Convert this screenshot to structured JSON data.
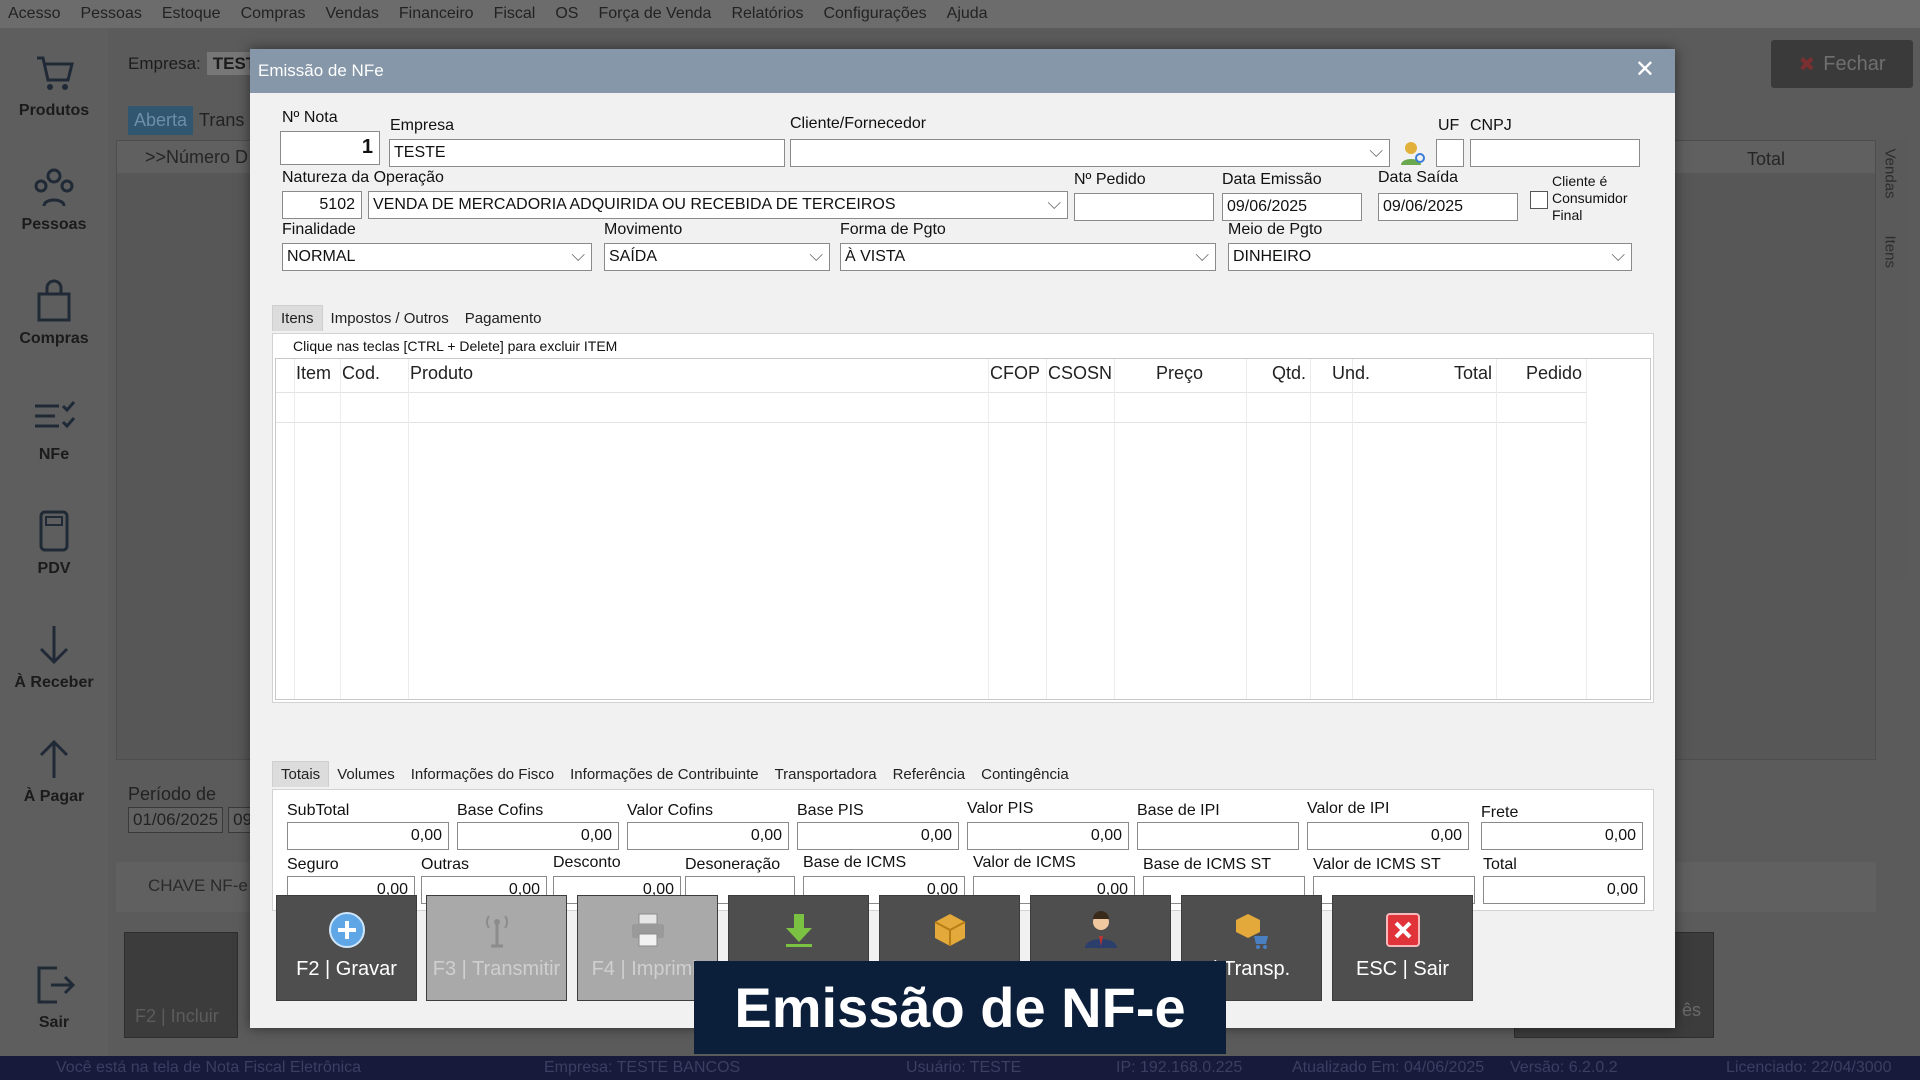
{
  "menubar": [
    "Acesso",
    "Pessoas",
    "Estoque",
    "Compras",
    "Vendas",
    "Financeiro",
    "Fiscal",
    "OS",
    "Força de Venda",
    "Relatórios",
    "Configurações",
    "Ajuda"
  ],
  "sidebar": {
    "items": [
      {
        "label": "Produtos",
        "icon": "cart-icon"
      },
      {
        "label": "Pessoas",
        "icon": "people-icon"
      },
      {
        "label": "Compras",
        "icon": "shopping-bag-icon"
      },
      {
        "label": "NFe",
        "icon": "checklist-icon"
      },
      {
        "label": "PDV",
        "icon": "pos-terminal-icon"
      },
      {
        "label": "À Receber",
        "icon": "arrow-down-icon"
      },
      {
        "label": "À Pagar",
        "icon": "arrow-up-icon"
      },
      {
        "label": "Sair",
        "icon": "exit-icon"
      }
    ]
  },
  "background": {
    "empresa_label": "Empresa:",
    "empresa_value": "TEST",
    "fechar": "Fechar",
    "tab_aberta": "Aberta",
    "tab_trans": "Trans",
    "grid_header_numero": ">>Número D",
    "grid_header_total": "Total",
    "side_vendas": "Vendas",
    "side_itens": "Itens",
    "periodo_label": "Período de",
    "periodo_date": "01/06/2025",
    "periodo_date2": "09",
    "chave": "CHAVE NF-e",
    "bg_btn_1": "F2 | Incluir",
    "bg_btn_last": "ês"
  },
  "statusbar": {
    "msg": "Você está na tela de Nota Fiscal Eletrônica",
    "empresa": "Empresa: TESTE BANCOS",
    "usuario": "Usuário: TESTE",
    "ip": "IP: 192.168.0.225",
    "atualizado": "Atualizado Em: 04/06/2025",
    "versao": "Versão: 6.2.0.2",
    "licenciado": "Licenciado: 22/04/3000"
  },
  "dialog": {
    "title": "Emissão de NFe",
    "close": "✕",
    "header": {
      "nota_label": "Nº Nota",
      "nota_value": "1",
      "empresa_label": "Empresa",
      "empresa_value": "TESTE",
      "cliente_label": "Cliente/Fornecedor",
      "cliente_value": "",
      "uf_label": "UF",
      "uf_value": "",
      "cnpj_label": "CNPJ",
      "cnpj_value": "",
      "natureza_label": "Natureza da Operação",
      "natureza_code": "5102",
      "natureza_value": "VENDA DE MERCADORIA ADQUIRIDA OU RECEBIDA DE TERCEIROS",
      "pedido_label": "Nº Pedido",
      "pedido_value": "",
      "emissao_label": "Data Emissão",
      "emissao_value": "09/06/2025",
      "saida_label": "Data Saída",
      "saida_value": "09/06/2025",
      "consumidor_label_1": "Cliente é",
      "consumidor_label_2": "Consumidor",
      "consumidor_label_3": "Final",
      "finalidade_label": "Finalidade",
      "finalidade_value": "NORMAL",
      "movimento_label": "Movimento",
      "movimento_value": "SAÍDA",
      "forma_label": "Forma de Pgto",
      "forma_value": "À VISTA",
      "meio_label": "Meio de Pgto",
      "meio_value": "DINHEIRO"
    },
    "item_tabs": [
      "Itens",
      "Impostos",
      "/ Outros",
      "Pagamento"
    ],
    "items_hint": "Clique nas teclas [CTRL + Delete] para excluir ITEM",
    "columns": [
      "Item",
      "Cod.",
      "Produto",
      "CFOP",
      "CSOSN",
      "Preço",
      "Qtd.",
      "Und.",
      "Total",
      "Pedido"
    ],
    "bottom_tabs": [
      "Totais",
      "Volumes",
      "Informações do Fisco",
      "Informações de Contribuinte",
      "Transportadora",
      "Referência",
      "Contingência"
    ],
    "totals_row1": [
      {
        "label": "SubTotal",
        "value": "0,00"
      },
      {
        "label": "Base Cofins",
        "value": "0,00"
      },
      {
        "label": "Valor Cofins",
        "value": "0,00"
      },
      {
        "label": "Base PIS",
        "value": "0,00"
      },
      {
        "label": "Valor PIS",
        "value": "0,00"
      },
      {
        "label": "Base de IPI",
        "value": ""
      },
      {
        "label": "Valor de IPI",
        "value": "0,00"
      },
      {
        "label": "Frete",
        "value": "0,00"
      }
    ],
    "totals_row2": [
      {
        "label": "Seguro",
        "value": "0,00"
      },
      {
        "label": "Outras",
        "value": "0,00"
      },
      {
        "label": "Desconto",
        "value": "0,00"
      },
      {
        "label": "Desoneração",
        "value": ""
      },
      {
        "label": "Base de ICMS",
        "value": "0,00"
      },
      {
        "label": "Valor de ICMS",
        "value": "0,00"
      },
      {
        "label": "Base de ICMS ST",
        "value": ""
      },
      {
        "label": "Valor de ICMS ST",
        "value": ""
      },
      {
        "label": "Total",
        "value": "0,00"
      }
    ],
    "buttons": [
      {
        "label": "F2 | Gravar",
        "icon": "plus-circle-icon"
      },
      {
        "label": "F3 | Transmitir",
        "icon": "antenna-icon"
      },
      {
        "label": "F4 | Imprimir",
        "icon": "printer-icon"
      },
      {
        "label": "",
        "icon": "download-arrow-icon"
      },
      {
        "label": "",
        "icon": "box-icon"
      },
      {
        "label": "",
        "icon": "person-icon"
      },
      {
        "label": "| Transp.",
        "icon": "box-cart-icon"
      },
      {
        "label": "ESC | Sair",
        "icon": "close-red-icon"
      }
    ]
  },
  "caption": "Emissão de NF-e",
  "colors": {
    "title_bar": "#8597a9",
    "button_bg": "#4e4e4e",
    "status_bg": "#171a3a",
    "caption_bg": "#0b1e3a"
  }
}
